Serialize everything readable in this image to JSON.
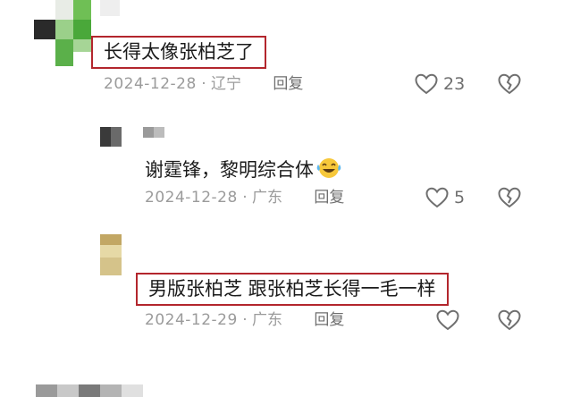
{
  "comments": [
    {
      "text": "长得太像张柏芝了",
      "date": "2024-12-28",
      "location": "辽宁",
      "reply_label": "回复",
      "likes": "23"
    },
    {
      "text": "谢霆锋，黎明综合体",
      "emoji": "laughing-crying-emoji",
      "date": "2024-12-28",
      "location": "广东",
      "reply_label": "回复",
      "likes": "5"
    },
    {
      "text": "男版张柏芝  跟张柏芝长得一毛一样",
      "date": "2024-12-29",
      "location": "广东",
      "reply_label": "回复",
      "likes": ""
    }
  ],
  "separator": "·",
  "colors": {
    "highlight_box": "#b3262d",
    "meta_gray": "#9b9b9b",
    "icon_gray": "#6f6f6f"
  }
}
